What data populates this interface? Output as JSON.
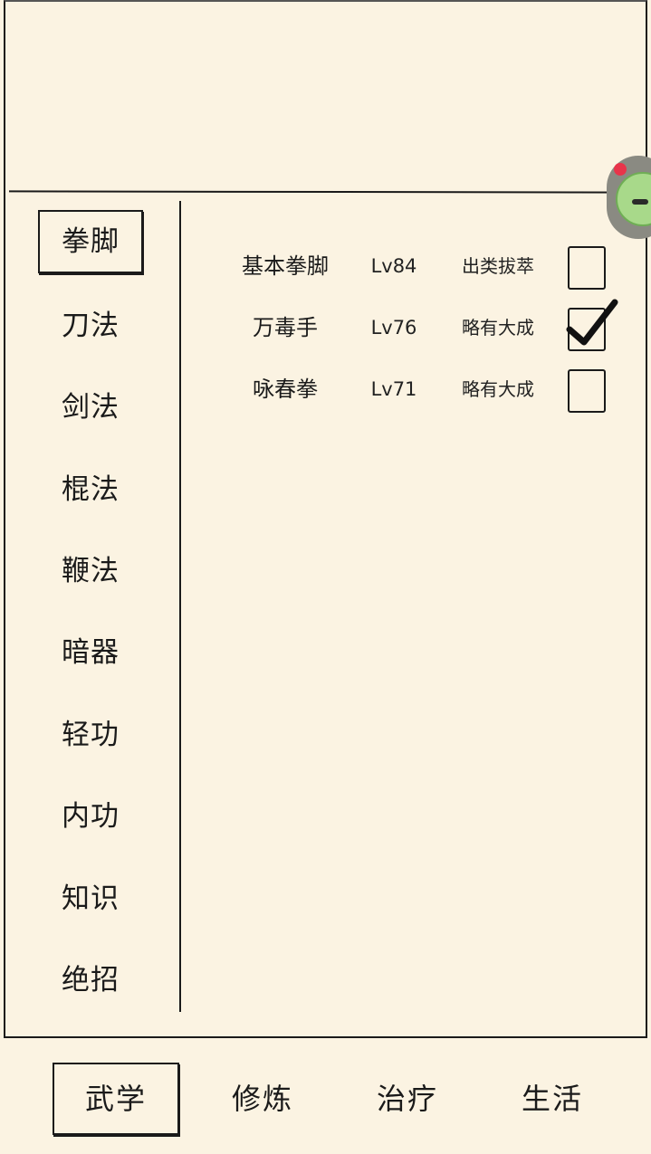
{
  "sidebar": {
    "items": [
      {
        "label": "拳脚"
      },
      {
        "label": "刀法"
      },
      {
        "label": "剑法"
      },
      {
        "label": "棍法"
      },
      {
        "label": "鞭法"
      },
      {
        "label": "暗器"
      },
      {
        "label": "轻功"
      },
      {
        "label": "内功"
      },
      {
        "label": "知识"
      },
      {
        "label": "绝招"
      }
    ],
    "selected": "拳脚"
  },
  "skills": [
    {
      "name": "基本拳脚",
      "level": "Lv84",
      "rank": "出类拔萃",
      "checked": false
    },
    {
      "name": "万毒手",
      "level": "Lv76",
      "rank": "略有大成",
      "checked": true
    },
    {
      "name": "咏春拳",
      "level": "Lv71",
      "rank": "略有大成",
      "checked": false
    }
  ],
  "bottom_tabs": [
    {
      "label": "武学"
    },
    {
      "label": "修炼"
    },
    {
      "label": "治疗"
    },
    {
      "label": "生活"
    }
  ],
  "bottom_selected": "武学",
  "colors": {
    "background": "#fbf3e2",
    "ink": "#1a1a1a",
    "notification_dot": "#e8344a",
    "avatar_green": "#a8d98a"
  },
  "icons": {
    "avatar": "floating-avatar-icon",
    "check": "checkmark-icon",
    "notification": "notification-dot-icon"
  }
}
